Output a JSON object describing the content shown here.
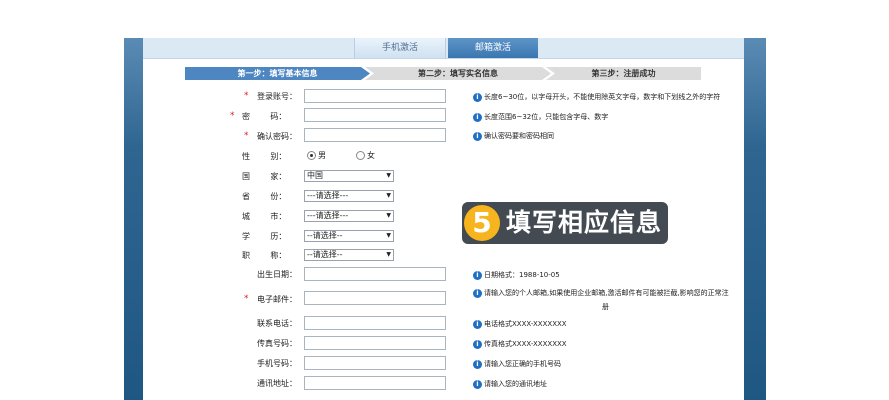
{
  "tabs": [
    {
      "label": "手机激活"
    },
    {
      "label": "邮箱激活"
    }
  ],
  "steps": [
    {
      "label": "第一步：填写基本信息"
    },
    {
      "label": "第二步：填写实名信息"
    },
    {
      "label": "第三步：注册成功"
    }
  ],
  "form": {
    "username": {
      "label": "登录账号：",
      "hint": "长度6~30位，以字母开头，不能使用除英文字母，数字和下划线之外的字符"
    },
    "password": {
      "label": "密        码：",
      "hint": "长度范围6~32位，只能包含字母、数字"
    },
    "confirm": {
      "label": "确认密码：",
      "hint": "确认密码要和密码相同"
    },
    "gender": {
      "label": "性        别：",
      "male": "男",
      "female": "女"
    },
    "country": {
      "label": "国        家：",
      "value": "中国"
    },
    "province": {
      "label": "省        份：",
      "value": "---请选择---"
    },
    "city": {
      "label": "城        市：",
      "value": "---请选择---"
    },
    "education": {
      "label": "学        历：",
      "value": "--请选择--"
    },
    "title": {
      "label": "职        称：",
      "value": "--请选择--"
    },
    "birthday": {
      "label": "出生日期：",
      "hint": "日期格式：1988-10-05"
    },
    "email": {
      "label": "电子邮件：",
      "hint": "请输入您的个人邮箱,如果使用企业邮箱,激活邮件有可能被拦截,影响您的正常注",
      "hint2": "册"
    },
    "phone": {
      "label": "联系电话：",
      "hint": "电话格式XXXX-XXXXXXX"
    },
    "fax": {
      "label": "传真号码：",
      "hint": "传真格式XXXX-XXXXXXX"
    },
    "mobile": {
      "label": "手机号码：",
      "hint": "请输入您正确的手机号码"
    },
    "address": {
      "label": "通讯地址：",
      "hint": "请输入您的通讯地址"
    }
  },
  "badge": {
    "number": "5",
    "text": "填写相应信息"
  }
}
